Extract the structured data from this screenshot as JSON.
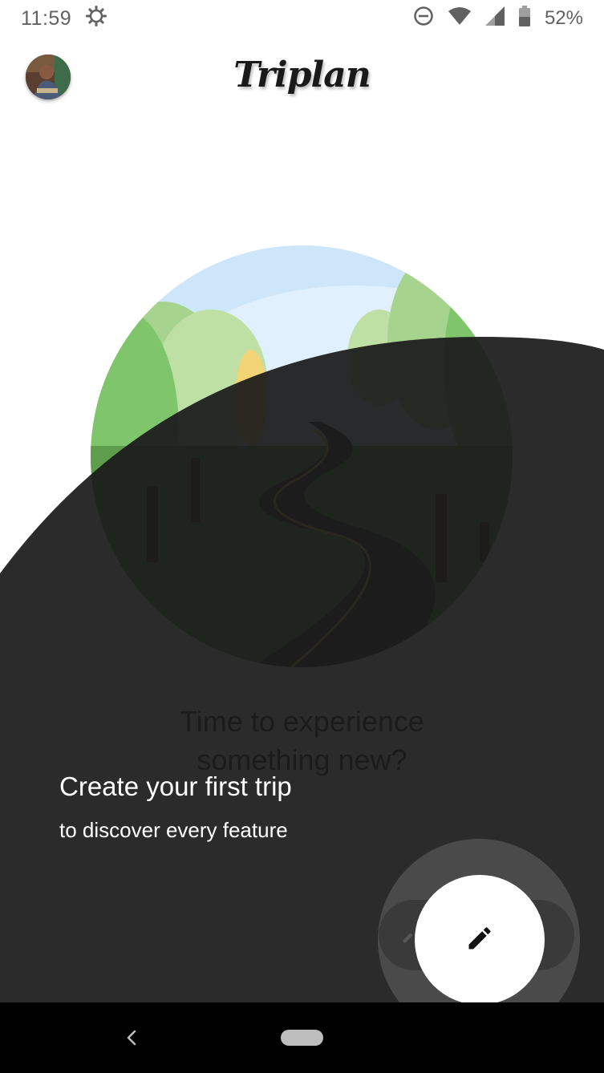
{
  "status_bar": {
    "time": "11:59",
    "battery_percent": "52%",
    "icons": [
      "settings-gear-icon",
      "do-not-disturb-icon",
      "wifi-icon",
      "cell-signal-icon",
      "battery-icon"
    ]
  },
  "app_bar": {
    "title": "Triplan",
    "avatar_icon": "user-avatar"
  },
  "empty_state": {
    "text_line1": "Time to experience",
    "text_line2": "something new?",
    "illustration_icon": "forest-road-illustration"
  },
  "tutorial": {
    "title": "Create your first trip",
    "subtitle": "to discover every feature"
  },
  "fab": {
    "icon": "pencil-icon"
  },
  "navigation": {
    "back_icon": "back-chevron-icon",
    "home_icon": "home-pill-icon"
  },
  "colors": {
    "overlay": "#1b1b1b",
    "fab_background": "#ffffff",
    "halo": "#4a4a4a",
    "sky": "#cde6fa",
    "tree_green": "#7ec56c",
    "road": "#2b3440"
  }
}
